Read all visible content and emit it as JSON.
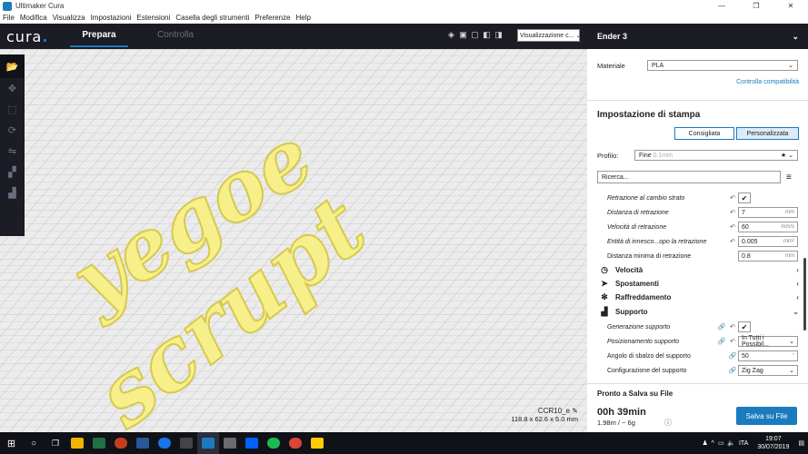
{
  "window": {
    "title": "Ultimaker Cura",
    "controls": [
      "—",
      "❐",
      "✕"
    ]
  },
  "menu": [
    "File",
    "Modifica",
    "Visualizza",
    "Impostazioni",
    "Estensioni",
    "Casella degli strumenti",
    "Preferenze",
    "Help"
  ],
  "header": {
    "logo": "cura",
    "logo_dot": ".",
    "stage_prepare": "Prepara",
    "stage_monitor": "Controlla",
    "view_select": "Visualizzazione c...",
    "view_icons": [
      "cube-3d-icon",
      "front-view-icon",
      "top-view-icon",
      "left-view-icon",
      "right-view-icon"
    ]
  },
  "toolbar": [
    "open-file-icon",
    "move-icon",
    "scale-icon",
    "rotate-icon",
    "mirror-icon",
    "per-model-settings-icon",
    "support-blocker-icon"
  ],
  "viewport": {
    "text_line1": "yegoe",
    "text_line2": "scrupt",
    "object_name": "CCR10_e",
    "object_dims": "118.8 x 62.6 x 5.0 mm"
  },
  "panel": {
    "printer": "Ender 3",
    "material_label": "Materiale",
    "material_value": "PLA",
    "compat_link": "Controlla compatibilità",
    "print_setup_title": "Impostazione di stampa",
    "tab_recommended": "Consigliata",
    "tab_custom": "Personalizzata",
    "profile_label": "Profilo:",
    "profile_value": "Fine",
    "profile_hint": "0.1mm",
    "search_placeholder": "Ricerca...",
    "settings": [
      {
        "label": "Retrazione al cambio strato",
        "type": "check",
        "checked": "✔",
        "italic": true
      },
      {
        "label": "Distanza di retrazione",
        "type": "value",
        "value": "7",
        "unit": "mm",
        "italic": true
      },
      {
        "label": "Velocità di retrazione",
        "type": "value",
        "value": "60",
        "unit": "mm/s",
        "italic": true
      },
      {
        "label": "Entità di innesco...opo la retrazione",
        "type": "value",
        "value": "0.005",
        "unit": "mm³",
        "italic": true
      },
      {
        "label": "Distanza minima di retrazione",
        "type": "value",
        "value": "0.8",
        "unit": "mm",
        "italic": false
      }
    ],
    "categories": [
      {
        "label": "Velocità",
        "icon": "speed-icon",
        "chev": "‹"
      },
      {
        "label": "Spostamenti",
        "icon": "travel-icon",
        "chev": "‹"
      },
      {
        "label": "Raffreddamento",
        "icon": "cooling-icon",
        "chev": "‹"
      },
      {
        "label": "Supporto",
        "icon": "support-icon",
        "chev": "⌄"
      }
    ],
    "support_settings": [
      {
        "label": "Generazione supporto",
        "type": "check",
        "checked": "✔",
        "italic": true
      },
      {
        "label": "Posizionamento supporto",
        "type": "select",
        "value": "In Tutti i Possibil...",
        "italic": true
      },
      {
        "label": "Angolo di sbalzo del supporto",
        "type": "value",
        "value": "50",
        "unit": "°",
        "italic": false
      },
      {
        "label": "Configurazione del supporto",
        "type": "select",
        "value": "Zig Zag",
        "italic": false
      }
    ],
    "output_title": "Pronto a Salva su File",
    "print_time": "00h 39min",
    "material_usage": "1.98m / ~ 6g",
    "save_button": "Salva su File"
  },
  "taskbar": {
    "apps": [
      "#2b2b2b",
      "#f0b400",
      "#1e7145",
      "#c43e1c",
      "#2b579a",
      "#1a73e8",
      "#444444",
      "#1b7bbf",
      "#6b6b6b",
      "#0061fe",
      "#1db954",
      "#db4437",
      "#ffcc00"
    ],
    "time": "19:07",
    "date": "30/07/2019",
    "lang": "ITA"
  }
}
